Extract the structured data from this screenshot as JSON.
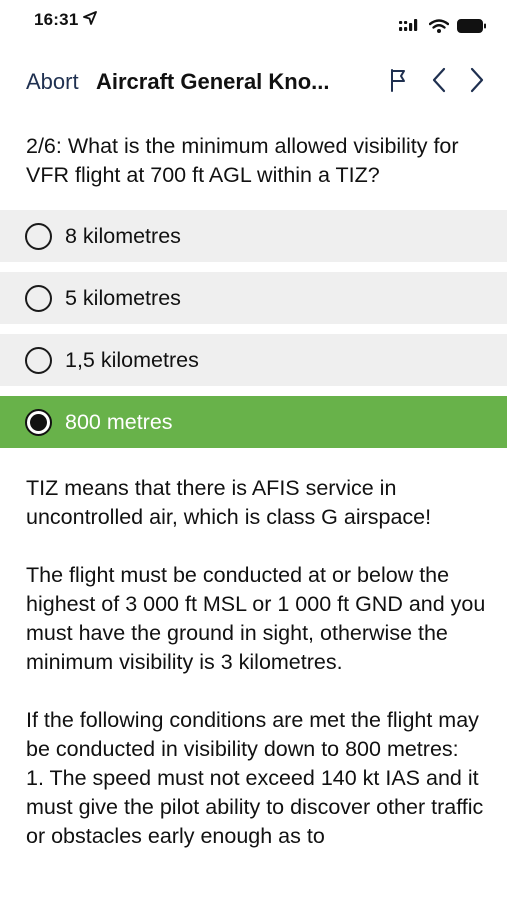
{
  "status_bar": {
    "time": "16:31"
  },
  "nav": {
    "abort_label": "Abort",
    "title": "Aircraft General Kno..."
  },
  "question": {
    "text": "2/6: What is the minimum allowed visibility for VFR flight at 700 ft AGL within a TIZ?"
  },
  "options": [
    {
      "label": "8 kilometres",
      "selected": false
    },
    {
      "label": "5 kilometres",
      "selected": false
    },
    {
      "label": "1,5 kilometres",
      "selected": false
    },
    {
      "label": "800 metres",
      "selected": true
    }
  ],
  "explanation": {
    "para1": "TIZ means that there is AFIS service in uncontrolled air, which is class G airspace!",
    "para2": "The flight must be conducted at or below the highest of 3 000 ft MSL or 1 000 ft GND and you must have the ground in sight, otherwise the minimum visibility is 3 kilometres.",
    "para3": "If the following conditions are met the flight may be conducted in visibility down to 800 metres:",
    "para4": "1. The speed must not exceed 140 kt IAS and it must give the pilot ability to discover other traffic or obstacles early enough as to"
  },
  "colors": {
    "selected_option": "#68b24a",
    "option_background": "#efefef",
    "abort_text": "#1f3050"
  },
  "icons": {
    "location": "location-arrow-icon",
    "signal": "cellular-signal-icon",
    "wifi": "wifi-icon",
    "battery": "battery-icon",
    "flag": "flag-icon",
    "previous": "chevron-left-icon",
    "next": "chevron-right-icon"
  }
}
